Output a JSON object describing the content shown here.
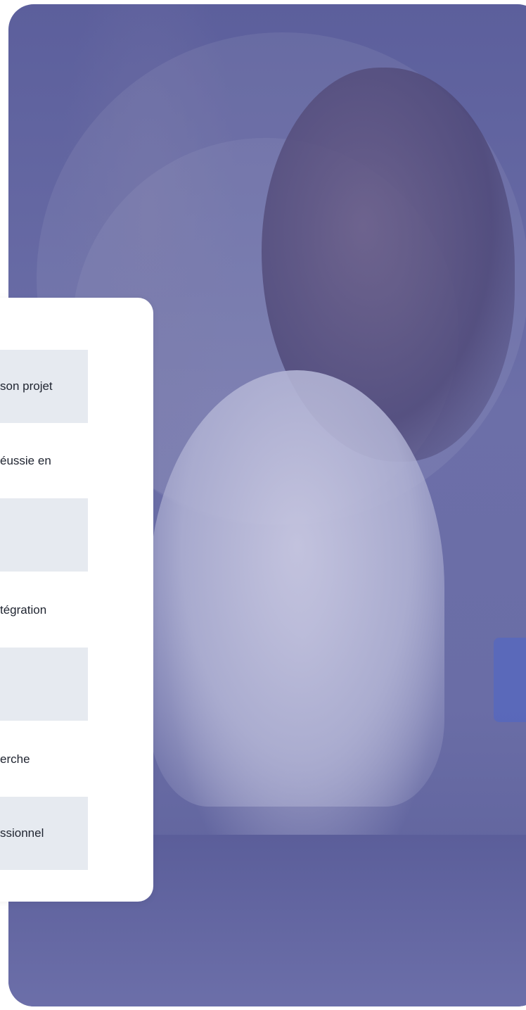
{
  "card": {
    "items": [
      {
        "label": "son projet",
        "shaded": true
      },
      {
        "label": "éussie en",
        "shaded": false
      },
      {
        "label": "",
        "shaded": true
      },
      {
        "label": "tégration",
        "shaded": false
      },
      {
        "label": "",
        "shaded": true
      },
      {
        "label": "erche",
        "shaded": false
      },
      {
        "label": "ssionnel",
        "shaded": true
      }
    ]
  },
  "colors": {
    "photo_tint": "#6a6da6",
    "card_background": "#ffffff",
    "item_shade": "#e6eaf0",
    "text": "#1f2430"
  }
}
